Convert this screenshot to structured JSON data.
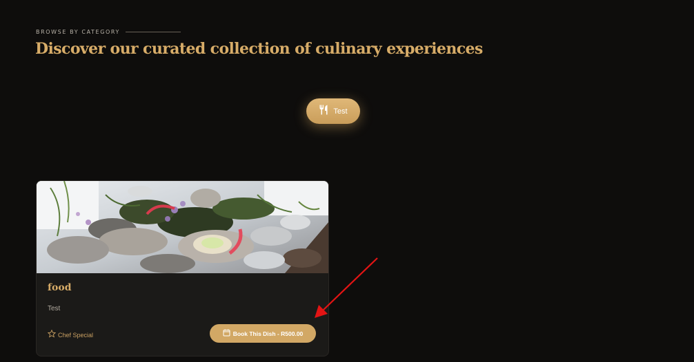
{
  "section": {
    "eyebrow": "BROWSE BY CATEGORY",
    "heading": "Discover our curated collection of culinary experiences"
  },
  "categories": [
    {
      "label": "Test",
      "icon": "utensils-icon",
      "active": true
    }
  ],
  "dishes": [
    {
      "title": "food",
      "description": "Test",
      "badge": {
        "label": "Chef Special",
        "icon": "star-icon"
      },
      "button": {
        "label": "Book This Dish - R500.00",
        "icon": "calendar-icon"
      },
      "image": "oysters-platter-photo"
    }
  ],
  "colors": {
    "background": "#0e0d0c",
    "accent_gold": "#d7ac68",
    "card_background": "#1b1a18",
    "annotation_red": "#e31414"
  }
}
